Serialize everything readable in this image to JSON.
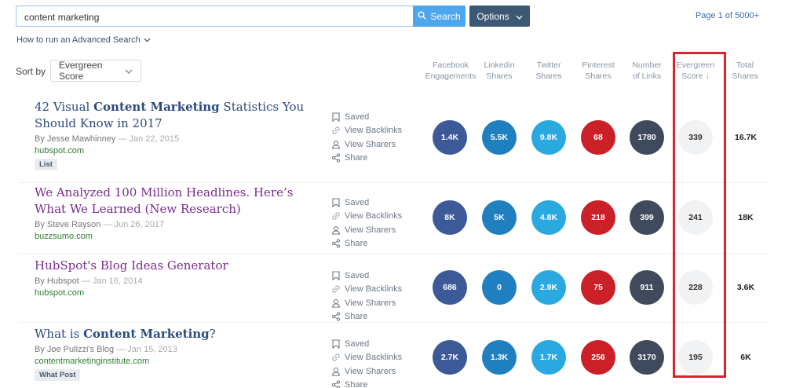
{
  "search": {
    "value": "content marketing",
    "button_label": "Search"
  },
  "options": {
    "label": "Options"
  },
  "pagination": {
    "info": "Page 1 of 5000+"
  },
  "advanced_link": "How to run an Advanced Search",
  "sort": {
    "label": "Sort by",
    "selected": "Evergreen Score"
  },
  "columns": {
    "facebook": [
      "Facebook",
      "Engagements"
    ],
    "linkedin": [
      "Linkedin",
      "Shares"
    ],
    "twitter": [
      "Twitter",
      "Shares"
    ],
    "pinterest": [
      "Pinterest",
      "Shares"
    ],
    "links": [
      "Number",
      "of Links"
    ],
    "evergreen": [
      "Evergreen",
      "Score ↓"
    ],
    "total": [
      "Total",
      "Shares"
    ]
  },
  "colors": {
    "facebook": "#3d5a98",
    "linkedin": "#1f7fbf",
    "twitter": "#2aa9e0",
    "pinterest": "#cb2027",
    "links": "#3f4a5c",
    "highlight": "#e0202a"
  },
  "actions": [
    "Saved",
    "View Backlinks",
    "View Sharers",
    "Share"
  ],
  "action_icons": [
    "bookmark-icon",
    "link-icon",
    "user-icon",
    "share-icon"
  ],
  "results": [
    {
      "title_parts": [
        [
          "42 Visual ",
          false
        ],
        [
          "Content Marketing",
          true
        ],
        [
          " Statistics You Should Know in 2017",
          false
        ]
      ],
      "visited": false,
      "author": "By Jesse Mawhinney",
      "date": "Jan 22, 2015",
      "domain": "hubspot.com",
      "tag": "List",
      "facebook": "1.4K",
      "linkedin": "5.5K",
      "twitter": "9.8K",
      "pinterest": "68",
      "links": "1780",
      "evergreen": "339",
      "total": "16.7K"
    },
    {
      "title_parts": [
        [
          "We Analyzed 100 Million Headlines. Here’s What We Learned (New Research)",
          false
        ]
      ],
      "visited": true,
      "author": "By Steve Rayson",
      "date": "Jun 26, 2017",
      "domain": "buzzsumo.com",
      "tag": "",
      "facebook": "8K",
      "linkedin": "5K",
      "twitter": "4.8K",
      "pinterest": "218",
      "links": "399",
      "evergreen": "241",
      "total": "18K"
    },
    {
      "title_parts": [
        [
          "HubSpot's Blog Ideas Generator",
          false
        ]
      ],
      "visited": true,
      "author": "By Hubspot",
      "date": "Jan 16, 2014",
      "domain": "hubspot.com",
      "tag": "",
      "facebook": "686",
      "linkedin": "0",
      "twitter": "2.9K",
      "pinterest": "75",
      "links": "911",
      "evergreen": "228",
      "total": "3.6K"
    },
    {
      "title_parts": [
        [
          "What is ",
          false
        ],
        [
          "Content Marketing",
          true
        ],
        [
          "?",
          false
        ]
      ],
      "visited": false,
      "author": "By Joe Pulizzi's Blog",
      "date": "Jan 15, 2013",
      "domain": "contentmarketinginstitute.com",
      "tag": "What Post",
      "facebook": "2.7K",
      "linkedin": "1.3K",
      "twitter": "1.7K",
      "pinterest": "256",
      "links": "3170",
      "evergreen": "195",
      "total": "6K"
    }
  ]
}
